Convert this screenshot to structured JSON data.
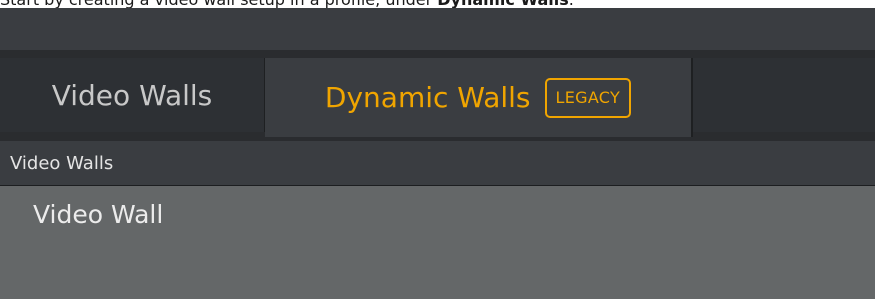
{
  "caption": {
    "prefix": "Start by creating a video wall setup in a profile, under ",
    "bold": "Dynamic Walls",
    "suffix": "."
  },
  "tabs": [
    {
      "label": "Video Walls",
      "active": false
    },
    {
      "label": "Dynamic Walls",
      "active": true,
      "badge": "LEGACY"
    }
  ],
  "section": {
    "header": "Video Walls",
    "items": [
      "Video Wall"
    ]
  },
  "colors": {
    "accent": "#f0a500",
    "tabbar_bg": "#2a2c2f",
    "panel_bg": "#3a3d41",
    "content_bg": "#646768"
  }
}
